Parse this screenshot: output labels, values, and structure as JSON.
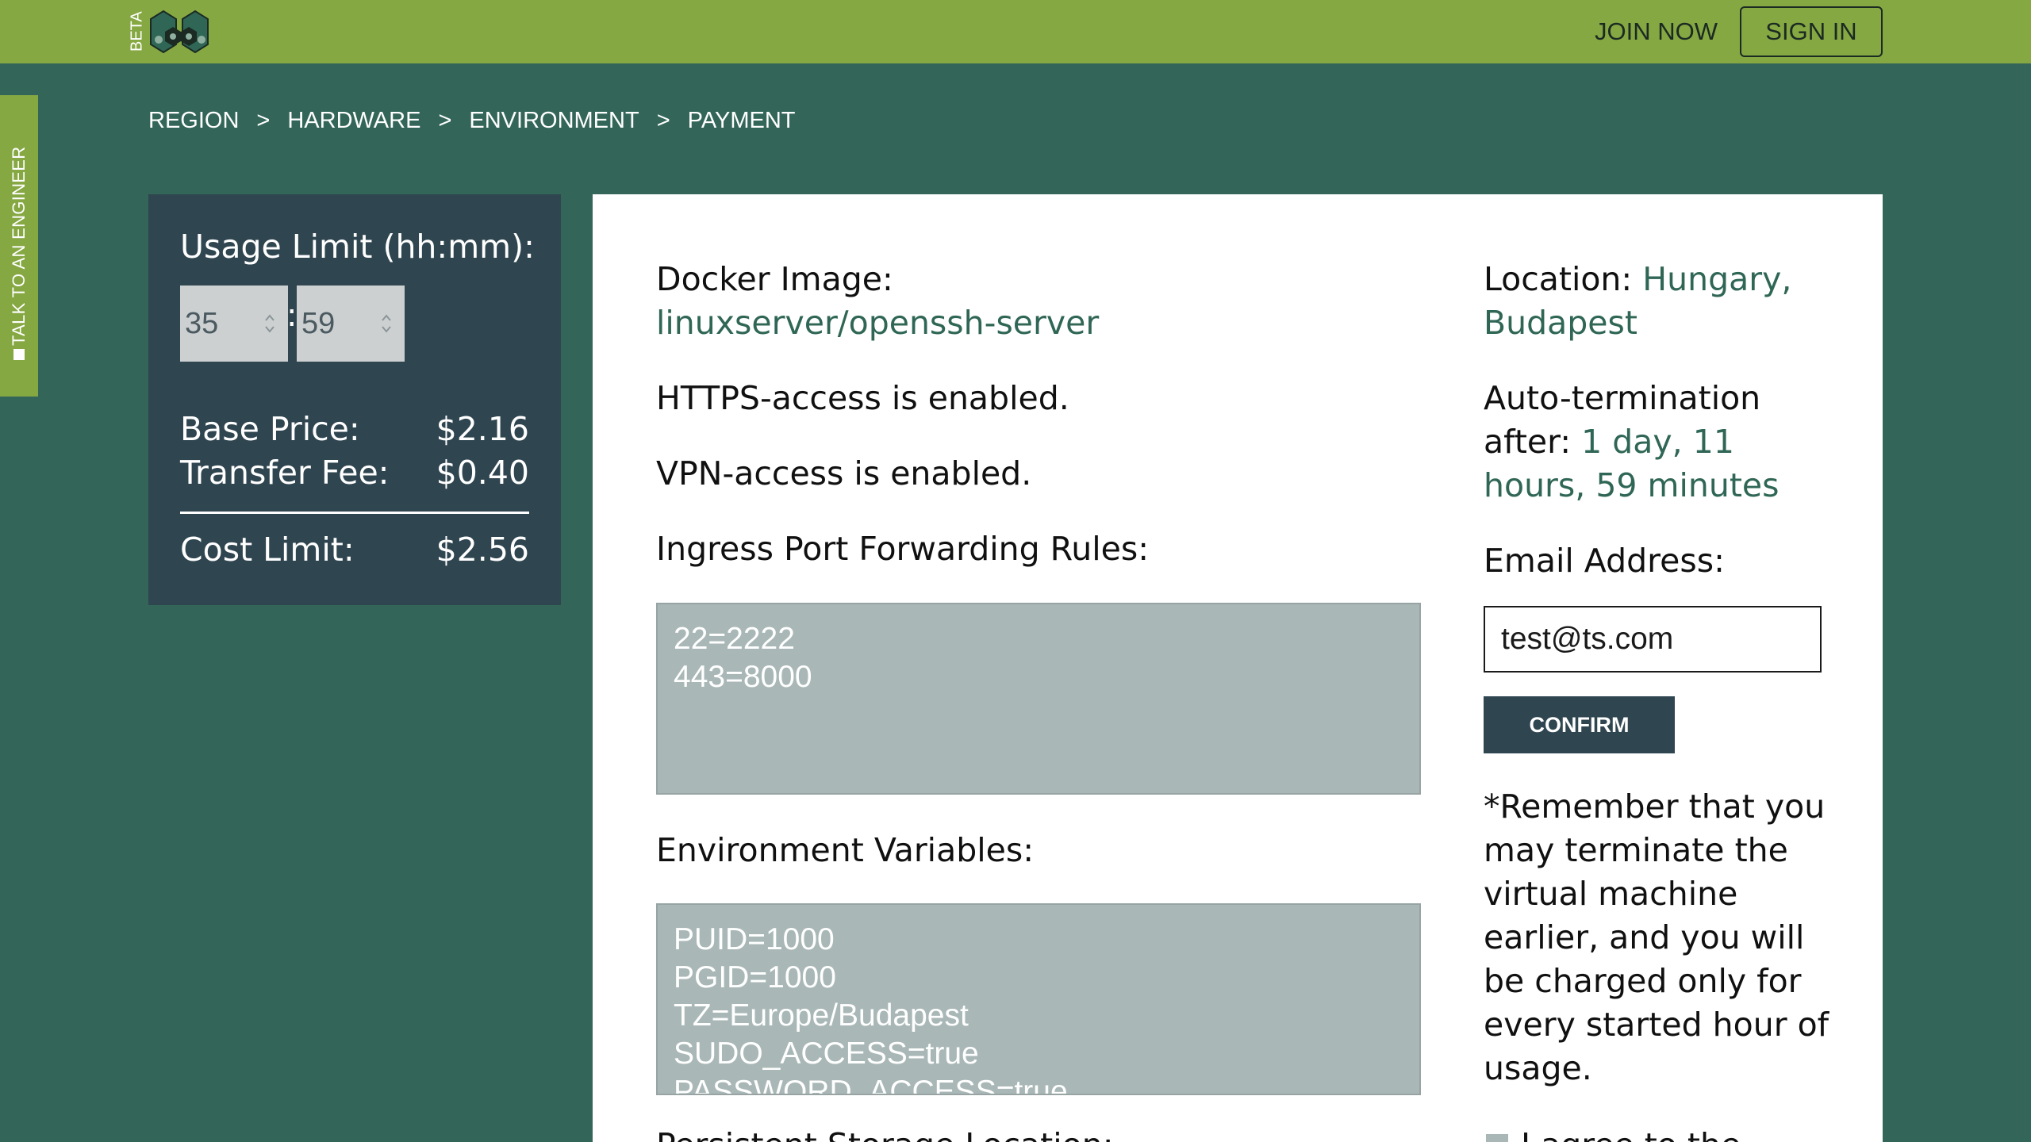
{
  "header": {
    "beta_label": "BETA",
    "join_label": "JOIN NOW",
    "signin_label": "SIGN IN"
  },
  "sidetab": {
    "label": "TALK TO AN ENGINEER"
  },
  "breadcrumb": {
    "items": [
      "REGION",
      "HARDWARE",
      "ENVIRONMENT",
      "PAYMENT"
    ],
    "separator": ">"
  },
  "usage": {
    "title": "Usage Limit (hh:mm):",
    "hours": "35",
    "minutes": "59",
    "colon": ":",
    "base_price_label": "Base Price:",
    "base_price_value": "$2.16",
    "transfer_fee_label": "Transfer Fee:",
    "transfer_fee_value": "$0.40",
    "cost_limit_label": "Cost Limit:",
    "cost_limit_value": "$2.56"
  },
  "summary": {
    "docker_label": "Docker Image:",
    "docker_value": "linuxserver/openssh-server",
    "https_text": "HTTPS-access is enabled.",
    "vpn_text": "VPN-access is enabled.",
    "ingress_label": "Ingress Port Forwarding Rules:",
    "ingress_value": "22=2222\n443=8000",
    "env_label": "Environment Variables:",
    "env_value": "PUID=1000\nPGID=1000\nTZ=Europe/Budapest\nSUDO_ACCESS=true\nPASSWORD_ACCESS=true",
    "storage_label": "Persistent Storage Location:"
  },
  "sidebar_info": {
    "location_label": "Location:",
    "location_value": "Hungary, Budapest",
    "autoterm_label_line1": "Auto-termination",
    "autoterm_label_line2": "after:",
    "autoterm_value": "1 day, 11 hours, 59 minutes",
    "email_label": "Email Address:",
    "email_value": "test@ts.com",
    "confirm_label": "CONFIRM",
    "reminder": "*Remember that you may terminate the virtual machine earlier, and you will be charged only for every started hour of usage.",
    "agree_text": "I agree to the"
  },
  "colors": {
    "background": "#336659",
    "topbar": "#86a843",
    "panel_dark": "#2f4550",
    "accent_text": "#2f6655",
    "textarea_bg": "#a9b8b7"
  }
}
